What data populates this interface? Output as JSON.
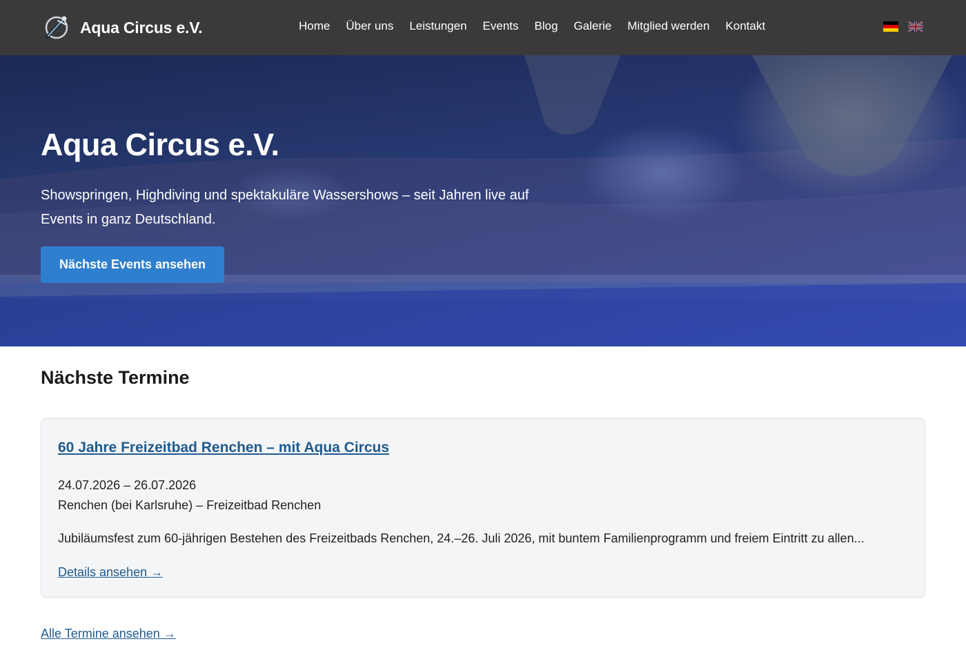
{
  "header": {
    "brand_title": "Aqua Circus e.V.",
    "nav": [
      {
        "label": "Home"
      },
      {
        "label": "Über uns"
      },
      {
        "label": "Leistungen"
      },
      {
        "label": "Events"
      },
      {
        "label": "Blog"
      },
      {
        "label": "Galerie"
      },
      {
        "label": "Mitglied werden"
      },
      {
        "label": "Kontakt"
      }
    ],
    "languages": [
      {
        "code": "de",
        "icon": "german-flag-icon",
        "active": true
      },
      {
        "code": "en",
        "icon": "uk-flag-icon",
        "active": false
      }
    ]
  },
  "hero": {
    "title": "Aqua Circus e.V.",
    "subtitle": "Showspringen, Highdiving und spektakuläre Wassershows – seit Jahren live auf Events in ganz Deutschland.",
    "cta_label": "Nächste Events ansehen"
  },
  "events_section": {
    "title": "Nächste Termine",
    "events": [
      {
        "title": "60 Jahre Freizeitbad Renchen – mit Aqua Circus",
        "date": "24.07.2026 – 26.07.2026",
        "location": "Renchen (bei Karlsruhe) – Freizeitbad Renchen",
        "description": "Jubiläumsfest zum 60-jährigen Bestehen des Freizeitbads Renchen, 24.–26. Juli 2026, mit buntem Familienprogramm und freiem Eintritt zu allen...",
        "details_label": "Details ansehen →"
      }
    ],
    "all_label": "Alle Termine ansehen →"
  },
  "colors": {
    "header_bg": "#3a3a3a",
    "accent": "#2f7fcf",
    "link": "#1f5a8c",
    "card_bg": "#f4f5f7"
  }
}
